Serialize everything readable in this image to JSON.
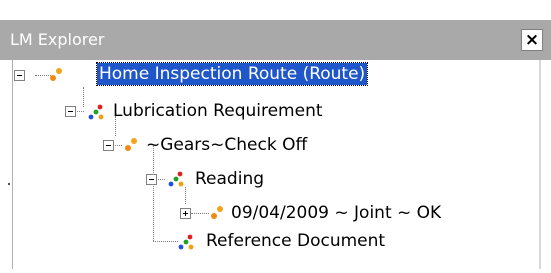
{
  "panel": {
    "title": "LM Explorer",
    "close_icon": "close-icon",
    "close_glyph": "×"
  },
  "tree": {
    "nodes": [
      {
        "label": "Home Inspection Route (Route)",
        "icon": "route-icon",
        "selected": true,
        "expander": "collapse"
      },
      {
        "label": "Lubrication Requirement",
        "icon": "multi-dot-icon",
        "expander": "collapse"
      },
      {
        "label": "~Gears~Check Off",
        "icon": "route-icon",
        "expander": "collapse"
      },
      {
        "label": "Reading",
        "icon": "multi-dot-icon",
        "expander": "collapse"
      },
      {
        "label": "09/04/2009 ~ Joint ~ OK",
        "icon": "route-icon",
        "expander": "expand"
      },
      {
        "label": "Reference Document",
        "icon": "multi-dot-icon",
        "expander": "none"
      }
    ]
  },
  "colors": {
    "titlebar": "#a9a9a9",
    "selection": "#1f56c9"
  }
}
